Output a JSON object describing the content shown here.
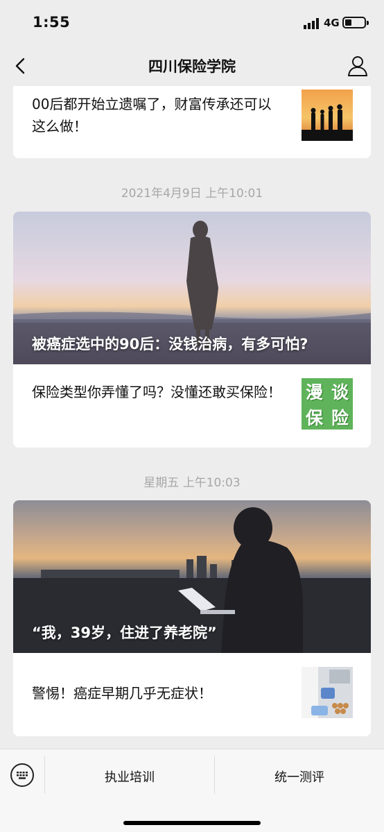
{
  "status_bar": {
    "time": "1:55",
    "network": "4G",
    "battery_level": 0.25
  },
  "nav": {
    "title": "四川保险学院"
  },
  "feed": {
    "item_top": {
      "text": "00后都开始立遗嘱了，财富传承还可以这么做！",
      "thumb_icon": "family-sunset-image"
    },
    "group1": {
      "timestamp": "2021年4月9日 上午10:01",
      "hero_title": "被癌症选中的90后：没钱治病，有多可怕?",
      "item": {
        "text": "保险类型你弄懂了吗？没懂还敢买保险！",
        "thumb_chars": [
          "漫",
          "谈",
          "保",
          "险"
        ],
        "thumb_color": "#5fb35a"
      }
    },
    "group2": {
      "timestamp": "星期五 上午10:03",
      "hero_title": "“我，39岁，住进了养老院”",
      "item": {
        "text": "警惕！癌症早期几乎无症状！",
        "thumb_icon": "lab-test-image"
      }
    }
  },
  "tabbar": {
    "keyboard_icon": "keyboard-icon",
    "tab1_label": "执业培训",
    "tab2_label": "统一测评"
  }
}
